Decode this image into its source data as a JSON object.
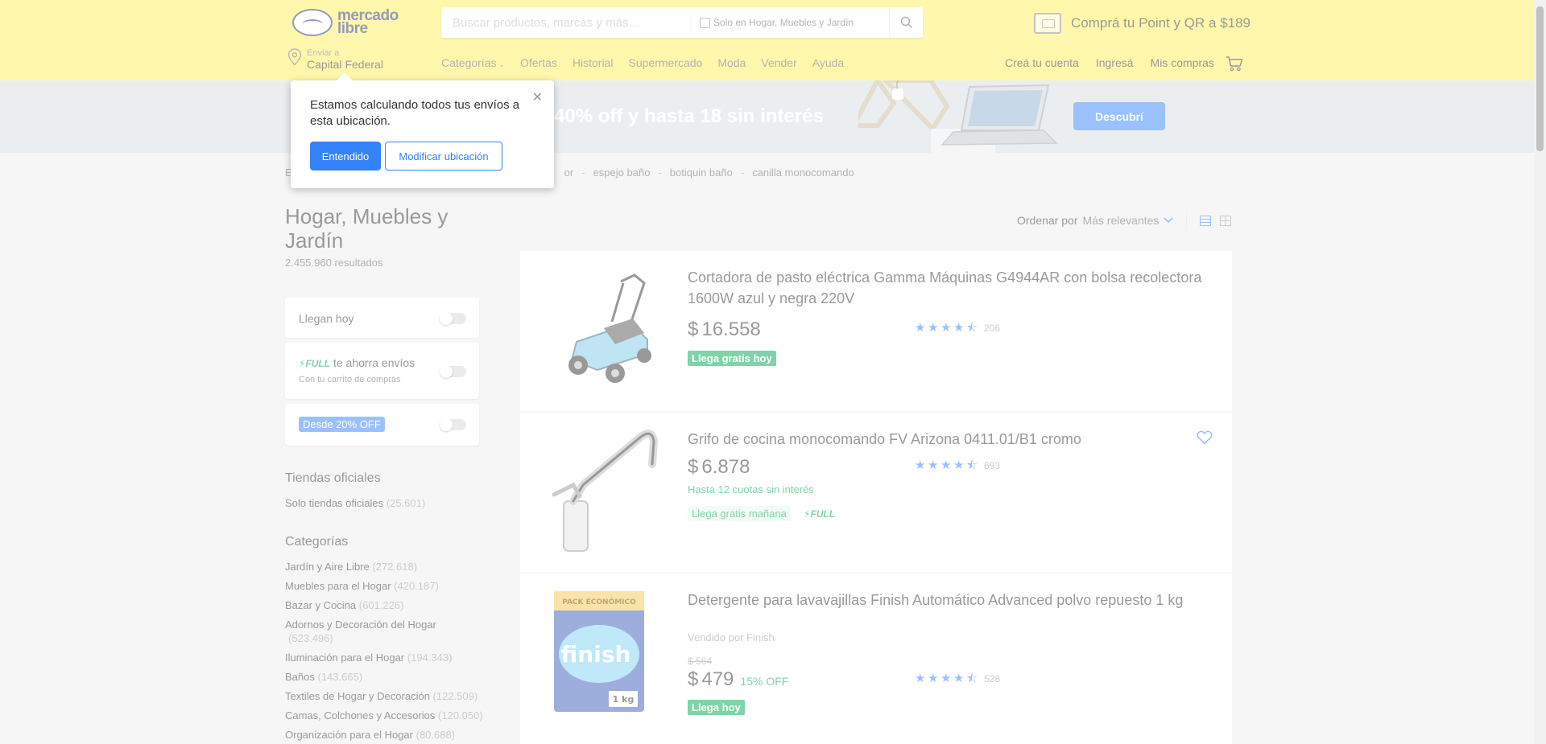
{
  "header": {
    "logo": {
      "line1": "mercado",
      "line2": "libre"
    },
    "search": {
      "placeholder": "Buscar productos, marcas y más…",
      "filter_label": "Solo en Hogar, Muebles y Jardín"
    },
    "promo_text": "Comprá tu Point y QR a $189",
    "location": {
      "label": "Enviar a",
      "value": "Capital Federal"
    },
    "nav": [
      "Categorías",
      "Ofertas",
      "Historial",
      "Supermercado",
      "Moda",
      "Vender",
      "Ayuda"
    ],
    "account": [
      "Creá tu cuenta",
      "Ingresá",
      "Mis compras"
    ]
  },
  "banner": {
    "text": "a 40% off y hasta 18 sin interés",
    "button": "Descubrí"
  },
  "popover": {
    "message": "Estamos calculando todos tus envíos a esta ubicación.",
    "primary": "Entendido",
    "secondary": "Modificar ubicación"
  },
  "breadcrumb": [
    "E",
    "or",
    "espejo baño",
    "botiquin baño",
    "canilla monocomando"
  ],
  "sidebar": {
    "title": "Hogar, Muebles y Jardín",
    "results": "2.455.960 resultados",
    "filters": {
      "llegan_hoy": "Llegan hoy",
      "full_badge": "FULL",
      "full_text": "te ahorra envíos",
      "full_sub": "Con tu carrito de compras",
      "discount": "Desde 20% OFF"
    },
    "tiendas": {
      "title": "Tiendas oficiales",
      "link": "Solo tiendas oficiales",
      "count": "(25.601)"
    },
    "categorias_title": "Categorías",
    "categorias": [
      {
        "name": "Jardín y Aire Libre",
        "count": "(272.618)"
      },
      {
        "name": "Muebles para el Hogar",
        "count": "(420.187)"
      },
      {
        "name": "Bazar y Cocina",
        "count": "(601.226)"
      },
      {
        "name": "Adornos y Decoración del Hogar",
        "count": "(523.496)"
      },
      {
        "name": "Iluminación para el Hogar",
        "count": "(194.343)"
      },
      {
        "name": "Baños",
        "count": "(143.665)"
      },
      {
        "name": "Textiles de Hogar y Decoración",
        "count": "(122.509)"
      },
      {
        "name": "Camas, Colchones y Accesorios",
        "count": "(120.050)"
      },
      {
        "name": "Organización para el Hogar",
        "count": "(80.688)"
      }
    ]
  },
  "sort": {
    "label": "Ordenar por",
    "value": "Más relevantes"
  },
  "products": [
    {
      "title": "Cortadora de pasto eléctrica Gamma Máquinas G4944AR con bolsa recolectora 1600W azul y negra 220V",
      "currency": "$",
      "price": "16.558",
      "rating_count": "206",
      "shipping": "Llega gratis hoy"
    },
    {
      "title": "Grifo de cocina monocomando FV Arizona 0411.01/B1 cromo",
      "currency": "$",
      "price": "6.878",
      "installments": "Hasta 12 cuotas sin interés",
      "rating_count": "693",
      "shipping": "Llega gratis mañana",
      "full": "FULL"
    },
    {
      "title": "Detergente para lavavajillas Finish Automático Advanced polvo repuesto 1 kg",
      "seller": "Vendido por Finish",
      "old_price": "$ 564",
      "currency": "$",
      "price": "479",
      "discount": "15% OFF",
      "rating_count": "528",
      "shipping": "Llega hoy",
      "pack_label": "PACK ECONÓMICO",
      "brand": "finish",
      "weight": "1 kg"
    }
  ],
  "colors": {
    "header_bg": "#fff159",
    "primary_blue": "#3483fa",
    "success_green": "#00a650",
    "logo_navy": "#2d3277"
  }
}
